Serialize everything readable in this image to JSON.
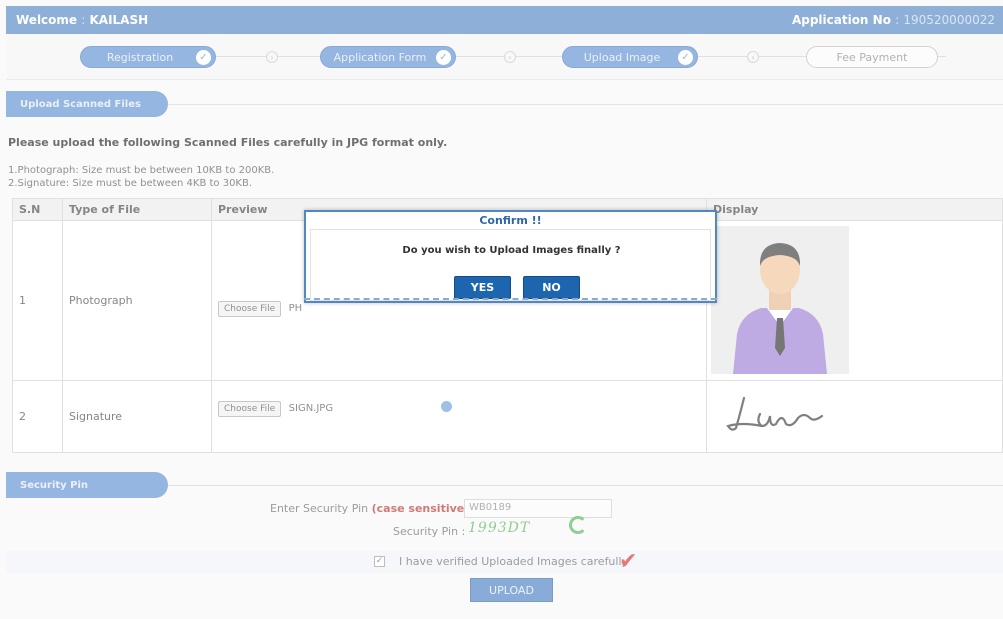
{
  "header": {
    "welcome_label": "Welcome",
    "user_name": "KAILASH",
    "app_no_label": "Application No",
    "app_no_value": "190520000022"
  },
  "steps": [
    {
      "label": "Registration",
      "state": "done"
    },
    {
      "label": "Application Form",
      "state": "done"
    },
    {
      "label": "Upload Image",
      "state": "done"
    },
    {
      "label": "Fee Payment",
      "state": "todo"
    }
  ],
  "upload_section": {
    "title": "Upload Scanned Files",
    "instructions": "Please upload the following Scanned Files carefully in JPG format only.",
    "rules": [
      "1.Photograph: Size must be between 10KB to 200KB.",
      "2.Signature: Size must be between 4KB to 30KB."
    ],
    "table": {
      "headers": [
        "S.N",
        "Type of File",
        "Preview",
        "Display"
      ],
      "rows": [
        {
          "sn": "1",
          "type": "Photograph",
          "choose_label": "Choose File",
          "file_name": "PH"
        },
        {
          "sn": "2",
          "type": "Signature",
          "choose_label": "Choose File",
          "file_name": "SIGN.JPG"
        }
      ]
    }
  },
  "security_section": {
    "title": "Security Pin",
    "enter_label": "Enter Security Pin",
    "case_label": "(case sensitive)",
    "colon": ":",
    "pin_value": "WB0189",
    "pin_label": "Security Pin :",
    "captcha_text": "1993DT",
    "verify_label": "I have verified Uploaded Images carefully",
    "verify_checked": true,
    "upload_label": "UPLOAD"
  },
  "dialog": {
    "title": "Confirm !!",
    "message": "Do you wish to Upload Images finally ?",
    "yes_label": "YES",
    "no_label": "NO"
  },
  "colors": {
    "accent": "#5285c2",
    "dialog_button": "#1e65b0",
    "captcha": "#56b356",
    "check_mark": "#d9302c"
  }
}
